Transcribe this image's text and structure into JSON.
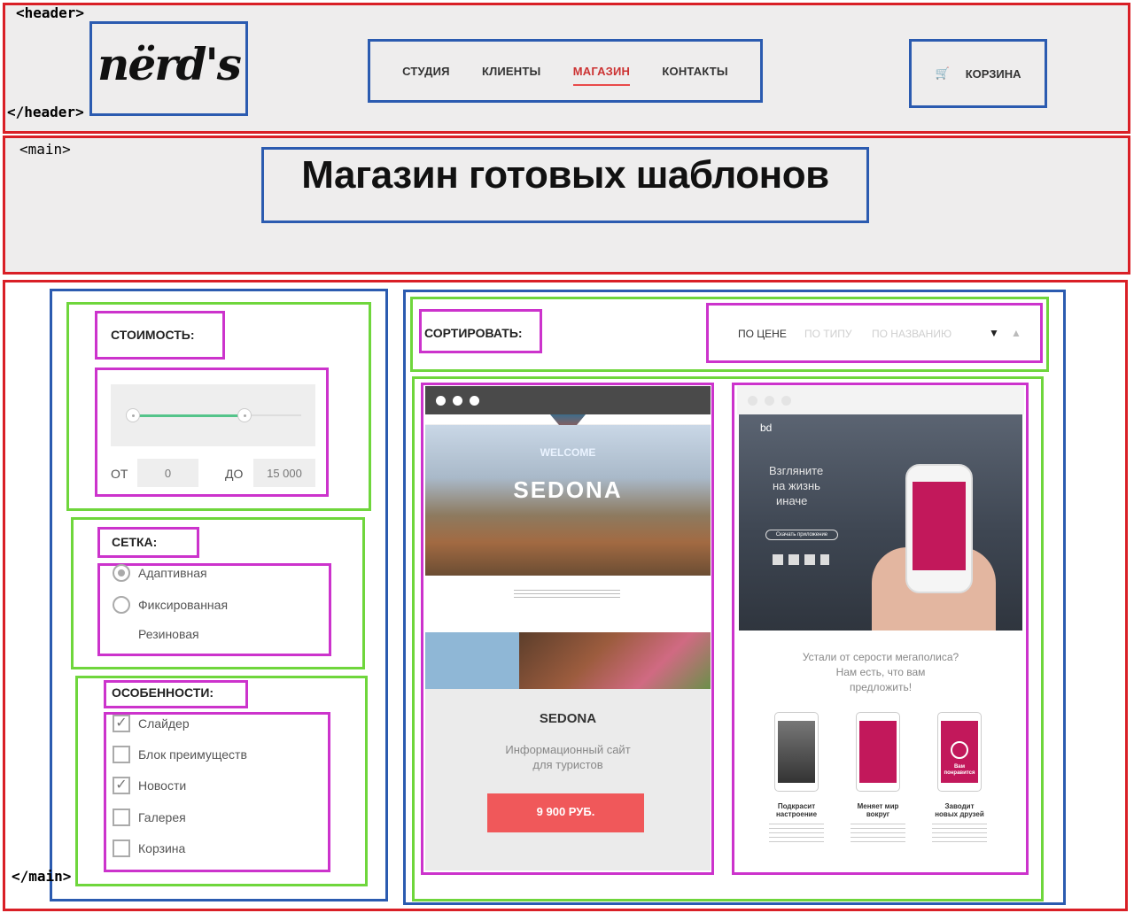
{
  "annotations": {
    "header_open": "<header>",
    "header_close": "</header>",
    "main_open": "<main>",
    "main_close": "</main>"
  },
  "header": {
    "logo": "nërd's",
    "nav": [
      {
        "label": "СТУДИЯ",
        "active": false
      },
      {
        "label": "КЛИЕНТЫ",
        "active": false
      },
      {
        "label": "МАГАЗИН",
        "active": true
      },
      {
        "label": "КОНТАКТЫ",
        "active": false
      }
    ],
    "cart_icon": "cart-icon",
    "cart_label": "КОРЗИНА"
  },
  "main": {
    "title": "Магазин готовых шаблонов"
  },
  "filters": {
    "price": {
      "heading": "СТОИМОСТЬ:",
      "from_label": "ОТ",
      "from_value": "0",
      "to_label": "ДО",
      "to_value": "15 000"
    },
    "grid": {
      "heading": "СЕТКА:",
      "options": [
        {
          "label": "Адаптивная",
          "checked": true
        },
        {
          "label": "Фиксированная",
          "checked": false
        },
        {
          "label": "Резиновая",
          "checked": false
        }
      ]
    },
    "features": {
      "heading": "ОСОБЕННОСТИ:",
      "options": [
        {
          "label": "Слайдер",
          "checked": true
        },
        {
          "label": "Блок преимуществ",
          "checked": false
        },
        {
          "label": "Новости",
          "checked": true
        },
        {
          "label": "Галерея",
          "checked": false
        },
        {
          "label": "Корзина",
          "checked": false
        }
      ]
    }
  },
  "sort": {
    "label": "СОРТИРОВАТЬ:",
    "options": [
      {
        "label": "ПО ЦЕНЕ",
        "active": true
      },
      {
        "label": "ПО ТИПУ",
        "active": false
      },
      {
        "label": "ПО НАЗВАНИЮ",
        "active": false
      }
    ],
    "desc_icon": "▼",
    "asc_icon": "▲"
  },
  "products": [
    {
      "preview_headline": "SEDONA",
      "preview_welcome": "WELCOME",
      "title": "SEDONA",
      "description_line1": "Информационный сайт",
      "description_line2": "для туристов",
      "price": "9 900 РУБ."
    },
    {
      "preview_brand": "bd",
      "preview_headline_1": "Взгляните",
      "preview_headline_2": "на жизнь",
      "preview_headline_3": "иначе",
      "preview_button": "Скачать приложение",
      "question_line1": "Устали от серости мегаполиса?",
      "question_line2": "Нам есть, что вам",
      "question_line3": "предложить!",
      "features": [
        {
          "caption": "Подкрасит\nнастроение"
        },
        {
          "caption": "Меняет мир\nвокруг"
        },
        {
          "caption": "Заводит\nновых друзей"
        }
      ],
      "badge": "Вам\nпонравится"
    }
  ],
  "colors": {
    "frame_red": "#d91f26",
    "frame_blue": "#2b5bb0",
    "frame_green": "#6fd63c",
    "frame_magenta": "#cc33cc",
    "accent_red": "#f0585a",
    "range_green": "#54c48a"
  }
}
